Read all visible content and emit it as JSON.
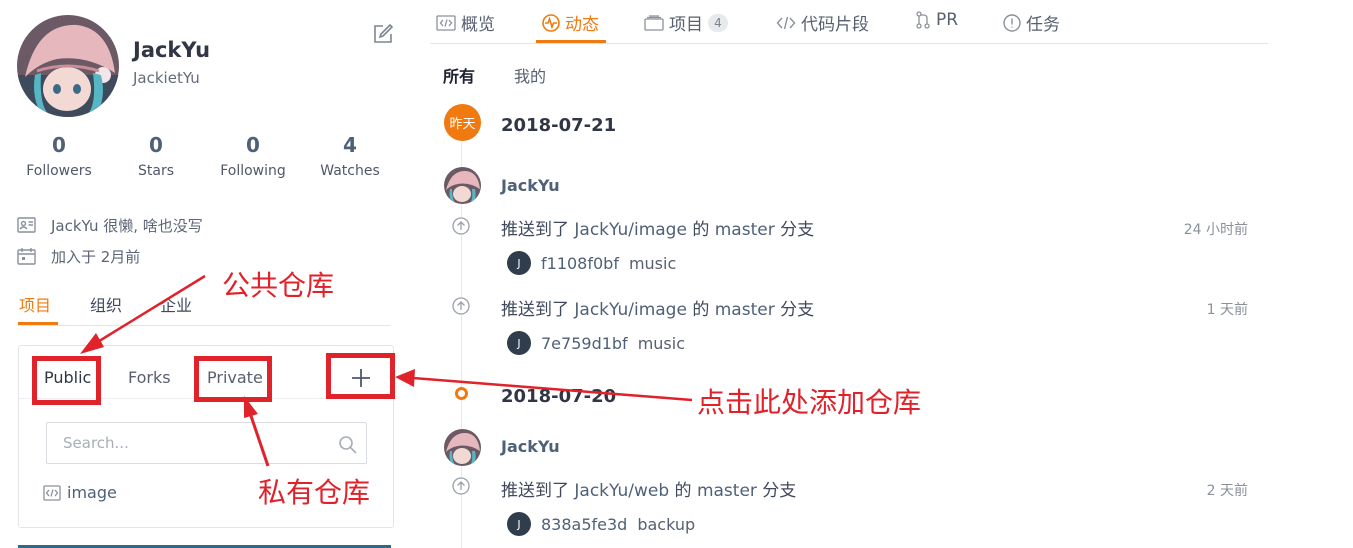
{
  "profile": {
    "name": "JackYu",
    "login": "JackietYu",
    "bio": "JackYu 很懒, 啥也没写",
    "joined": "加入于 2月前",
    "stats": [
      {
        "value": "0",
        "label": "Followers"
      },
      {
        "value": "0",
        "label": "Stars"
      },
      {
        "value": "0",
        "label": "Following"
      },
      {
        "value": "4",
        "label": "Watches"
      }
    ]
  },
  "profile_tabs": [
    "项目",
    "组织",
    "企业"
  ],
  "repo_panel": {
    "tabs": [
      "Public",
      "Forks",
      "Private"
    ],
    "search_placeholder": "Search...",
    "repos": [
      "image"
    ]
  },
  "main_tabs": [
    {
      "label": "概览"
    },
    {
      "label": "动态"
    },
    {
      "label": "项目",
      "badge": "4"
    },
    {
      "label": "代码片段"
    },
    {
      "label": "PR"
    },
    {
      "label": "任务"
    }
  ],
  "feed_filters": [
    "所有",
    "我的"
  ],
  "timeline": {
    "yesterday_label": "昨天",
    "dates": [
      "2018-07-21",
      "2018-07-20"
    ],
    "events": [
      {
        "user": "JackYu",
        "prefix": "推送到了",
        "repo": "JackYu/image",
        "mid": "的",
        "branch": "master",
        "suffix": "分支",
        "time": "24 小时前",
        "commit_initial": "J",
        "sha": "f1108f0bf",
        "message": "music"
      },
      {
        "prefix": "推送到了",
        "repo": "JackYu/image",
        "mid": "的",
        "branch": "master",
        "suffix": "分支",
        "time": "1 天前",
        "commit_initial": "J",
        "sha": "7e759d1bf",
        "message": "music"
      },
      {
        "user": "JackYu",
        "prefix": "推送到了",
        "repo": "JackYu/web",
        "mid": "的",
        "branch": "master",
        "suffix": "分支",
        "time": "2 天前",
        "commit_initial": "J",
        "sha": "838a5fe3d",
        "message": "backup"
      }
    ]
  },
  "annotations": {
    "public": "公共仓库",
    "private": "私有仓库",
    "add": "点击此处添加仓库"
  },
  "colors": {
    "accent": "#f07a10",
    "annotation_red": "#e0222a",
    "link": "#4f6178"
  }
}
